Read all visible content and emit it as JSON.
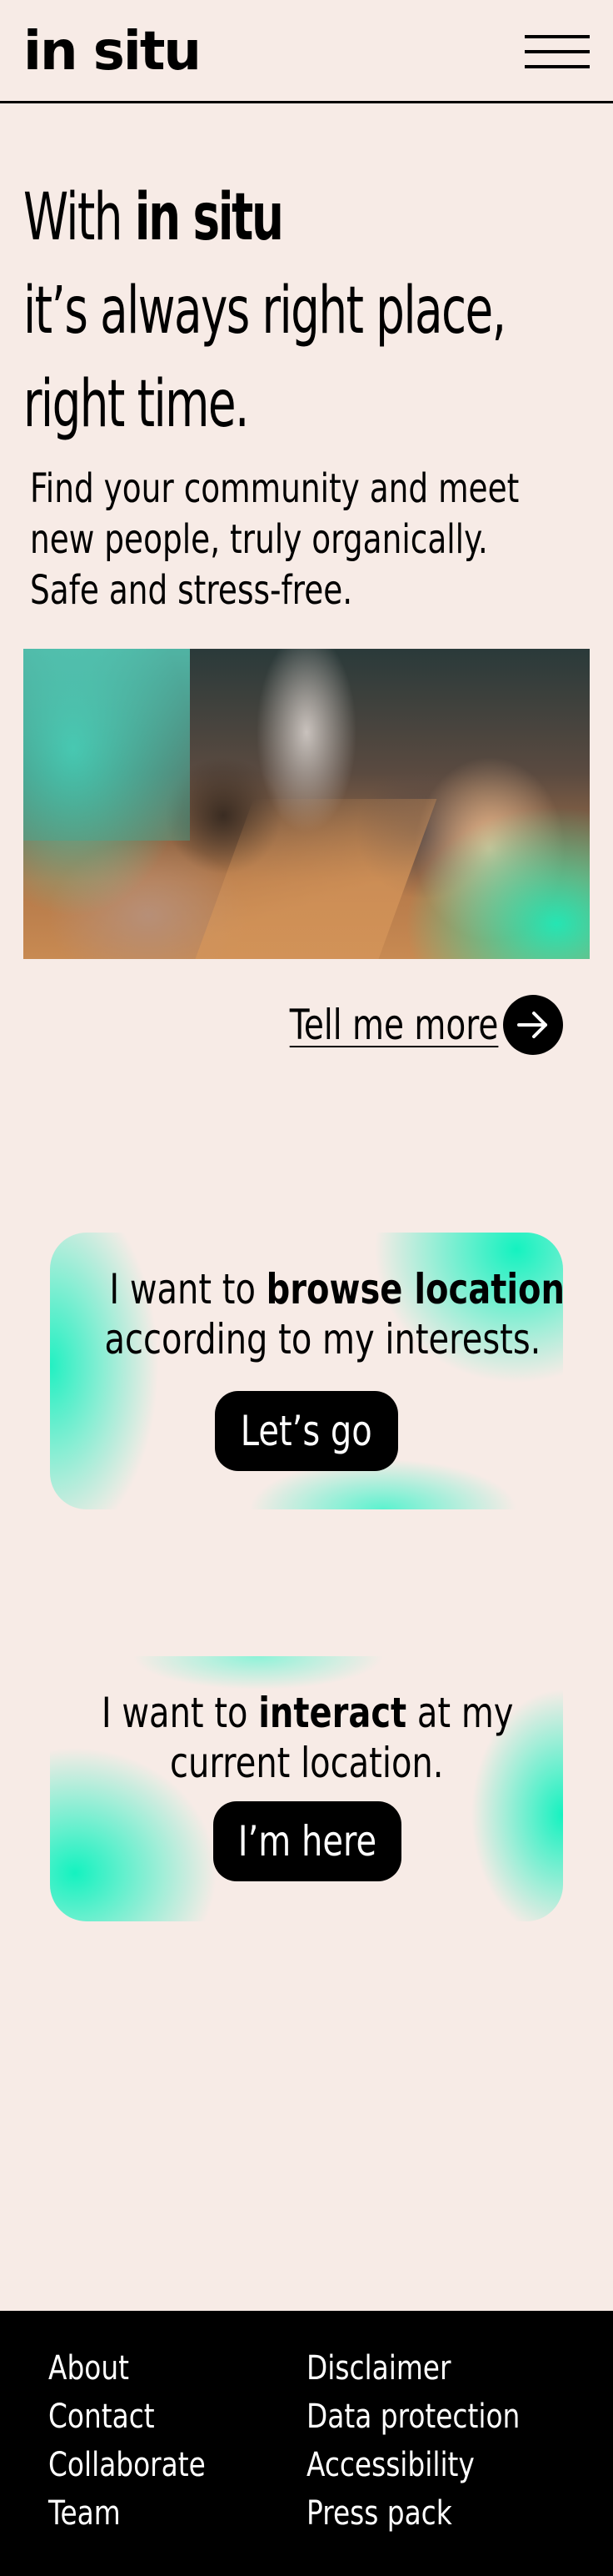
{
  "header": {
    "logo": "in situ",
    "menu_icon": "hamburger-menu-icon"
  },
  "hero": {
    "title_prefix": "With ",
    "title_brand": "in situ",
    "title_line2": "it’s always right place,",
    "title_line3": "right time.",
    "subtitle_line1": "Find your community and meet",
    "subtitle_line2": "new people, truly organically.",
    "subtitle_line3": "Safe and stress-free."
  },
  "tell_more": {
    "label": "Tell me more",
    "icon": "arrow-right-icon"
  },
  "cards": [
    {
      "text_prefix": "I want to ",
      "text_bold": "browse locations",
      "text_line2": "according to my interests.",
      "button_label": "Let’s go"
    },
    {
      "text_prefix": "I want to ",
      "text_bold": "interact",
      "text_suffix": " at my",
      "text_line2": "current location.",
      "button_label": "I’m here"
    }
  ],
  "footer": {
    "left_links": [
      "About",
      "Contact",
      "Collaborate",
      "Team"
    ],
    "right_links": [
      "Disclaimer",
      "Data protection",
      "Accessibility",
      "Press pack"
    ]
  },
  "colors": {
    "background": "#f7ebe6",
    "accent": "#14f2c0",
    "ink": "#000000"
  }
}
